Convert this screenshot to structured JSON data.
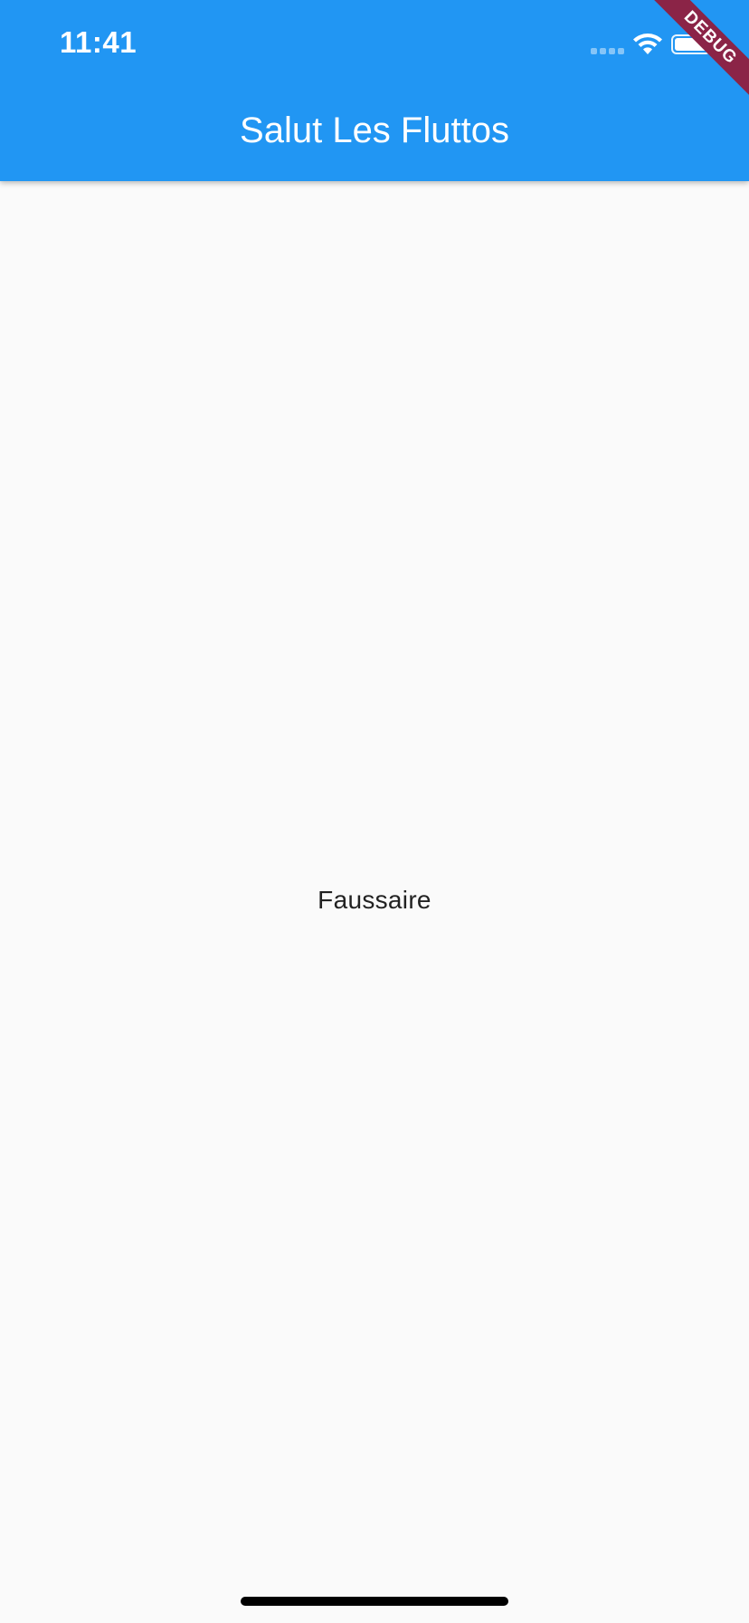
{
  "status_bar": {
    "time": "11:41",
    "signal_icon": "cellular-signal-icon",
    "wifi_icon": "wifi-icon",
    "battery_icon": "battery-icon"
  },
  "app_bar": {
    "title": "Salut Les Fluttos",
    "color": "#2196f3"
  },
  "body": {
    "text": "Faussaire",
    "background": "#fafafa"
  },
  "debug_banner": {
    "label": "DEBUG",
    "color": "#8b2447"
  }
}
